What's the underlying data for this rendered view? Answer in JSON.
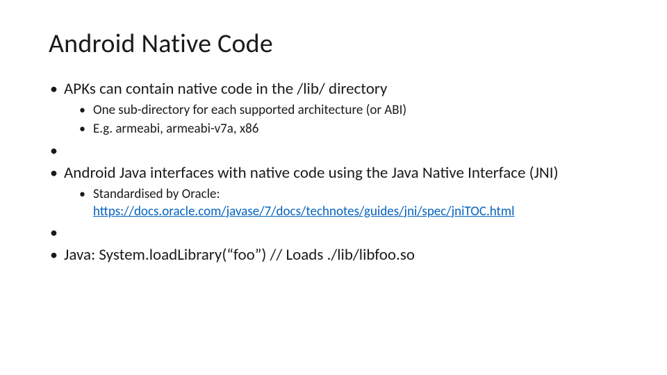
{
  "title": "Android Native Code",
  "bullets": {
    "b1": "APKs can contain native code in the /lib/ directory",
    "b1_sub1": "One sub-directory for each supported architecture (or ABI)",
    "b1_sub2": "E.g. armeabi, armeabi-v7a, x86",
    "b2": "Android Java interfaces with native code using the Java Native Interface (JNI)",
    "b2_sub1_prefix": "Standardised by Oracle: ",
    "b2_sub1_link": "https://docs.oracle.com/javase/7/docs/technotes/guides/jni/spec/jniTOC.html",
    "b3": "Java: System.loadLibrary(“foo”)   //  Loads ./lib/libfoo.so"
  }
}
